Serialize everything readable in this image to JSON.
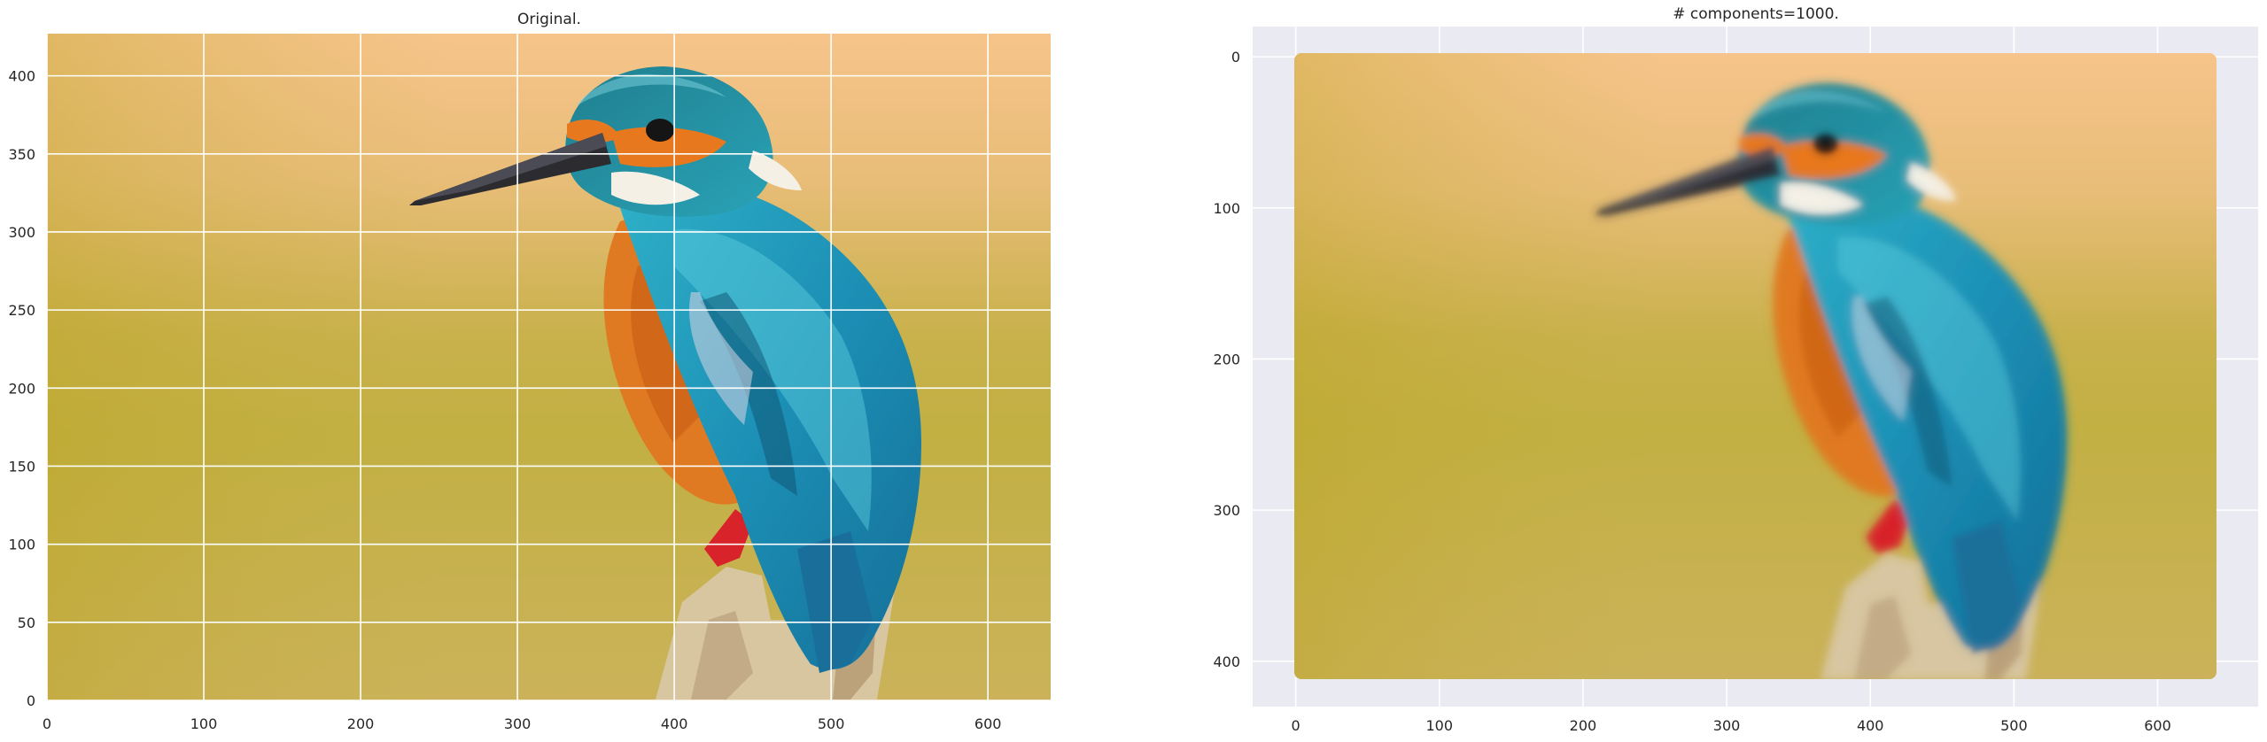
{
  "chart_data": [
    {
      "type": "image",
      "title": "Original.",
      "image_content": "kingfisher-photo",
      "xlabel": "",
      "ylabel": "",
      "xlim": [
        0,
        640
      ],
      "ylim": [
        427,
        0
      ],
      "xticks": [
        0,
        100,
        200,
        300,
        400,
        500,
        600
      ],
      "yticks": [
        0,
        50,
        100,
        150,
        200,
        250,
        300,
        350,
        400
      ],
      "grid": true,
      "colors": {
        "background": "#ffffff",
        "grid": "#ffffff"
      }
    },
    {
      "type": "image",
      "title": "# components=1000.",
      "image_content": "kingfisher-reconstruction-1000-components",
      "xlabel": "",
      "ylabel": "",
      "xlim": [
        -30,
        670
      ],
      "ylim": [
        -20,
        430
      ],
      "xticks": [
        0,
        100,
        200,
        300,
        400,
        500,
        600
      ],
      "yticks": [
        0,
        100,
        200,
        300,
        400
      ],
      "grid": true,
      "colors": {
        "background": "#eaeaf2",
        "grid": "#ffffff"
      }
    }
  ]
}
